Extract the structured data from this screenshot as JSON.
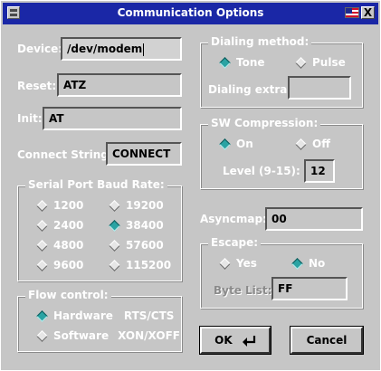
{
  "window": {
    "title": "Communication Options",
    "flag_icon": "us-flag-icon",
    "close_label": "X"
  },
  "left": {
    "device": {
      "label": "Device:",
      "value": "/dev/modem"
    },
    "reset": {
      "label": "Reset:",
      "value": "ATZ"
    },
    "init": {
      "label": "Init:",
      "value": "AT"
    },
    "connect": {
      "label": "Connect String:",
      "value": "CONNECT"
    },
    "baud": {
      "title": "Serial Port Baud Rate:",
      "options": [
        "1200",
        "19200",
        "2400",
        "38400",
        "4800",
        "57600",
        "9600",
        "115200"
      ],
      "selected": "38400"
    },
    "flow": {
      "title": "Flow control:",
      "options": [
        {
          "name": "Hardware",
          "detail": "RTS/CTS"
        },
        {
          "name": "Software",
          "detail": "XON/XOFF"
        }
      ],
      "selected": "Hardware"
    }
  },
  "right": {
    "dialing": {
      "title": "Dialing method:",
      "options": [
        "Tone",
        "Pulse"
      ],
      "selected": "Tone",
      "extras_label": "Dialing extras:",
      "extras_value": ""
    },
    "compression": {
      "title": "SW Compression:",
      "options": [
        "On",
        "Off"
      ],
      "selected": "On",
      "level_label": "Level (9-15):",
      "level_value": "12"
    },
    "asyncmap": {
      "label": "Asyncmap:",
      "value": "00"
    },
    "escape": {
      "title": "Escape:",
      "options": [
        "Yes",
        "No"
      ],
      "selected": "No",
      "byte_list_label": "Byte List:",
      "byte_list_value": "FF"
    }
  },
  "buttons": {
    "ok": "OK",
    "cancel": "Cancel",
    "ok_icon": "enter-arrow-icon"
  },
  "colors": {
    "titlebar": "#1a27a6",
    "window": "#c6c6c6",
    "radio_on": "#2aa3a3"
  }
}
